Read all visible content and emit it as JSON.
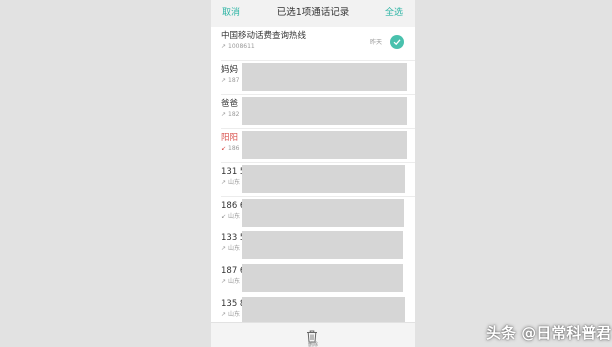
{
  "header": {
    "cancel": "取消",
    "title": "已选1项通话记录",
    "select_all": "全选"
  },
  "calls": [
    {
      "name": "中国移动话费查询热线",
      "sub": "1008611",
      "direction": "outgoing",
      "time": "昨天",
      "selected": true,
      "missed": false
    },
    {
      "name": "妈妈",
      "sub": "187",
      "direction": "outgoing",
      "missed": false
    },
    {
      "name": "爸爸",
      "sub": "182",
      "direction": "outgoing",
      "missed": false
    },
    {
      "name": "阳阳",
      "sub": "186",
      "direction": "missed",
      "missed": true
    },
    {
      "name": "131 5",
      "sub": "山东",
      "direction": "outgoing",
      "missed": false
    },
    {
      "name": "186 6",
      "sub": "山东",
      "direction": "incoming",
      "missed": false
    },
    {
      "name": "133 5",
      "sub": "山东",
      "direction": "outgoing",
      "missed": false
    },
    {
      "name": "187 6",
      "sub": "山东",
      "direction": "outgoing",
      "missed": false
    },
    {
      "name": "135 8",
      "sub": "山东",
      "direction": "outgoing",
      "missed": false
    }
  ],
  "toolbar": {
    "delete_icon": "trash-icon",
    "delete_label": "删除"
  },
  "watermark": "头条 @日常科普君",
  "colors": {
    "accent": "#2fb5a5",
    "missed": "#d9534f"
  }
}
